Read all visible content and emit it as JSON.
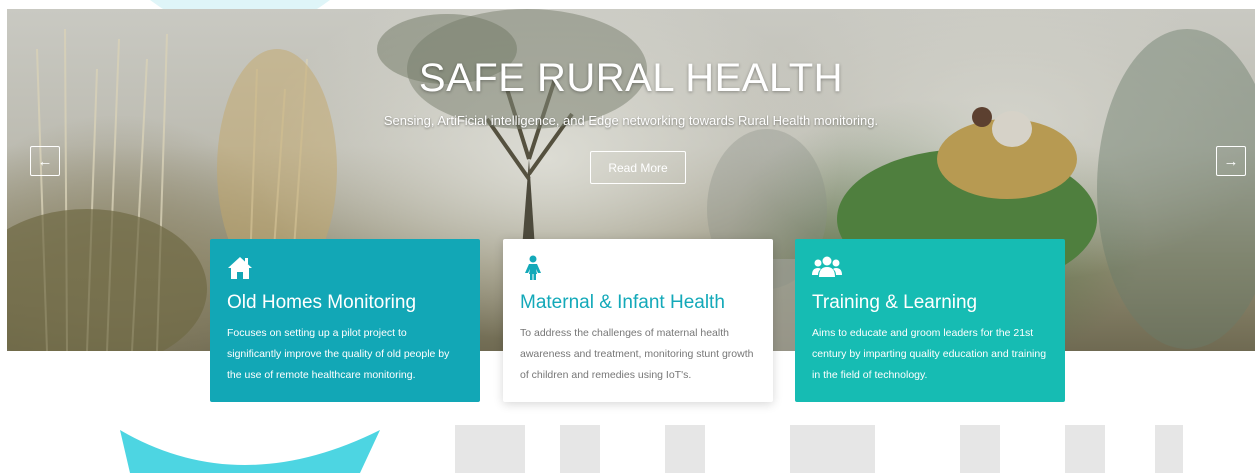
{
  "hero": {
    "title": "SAFE RURAL HEALTH",
    "subtitle": "Sensing, ArtiFicial intelligence, and Edge networking towards Rural Health monitoring.",
    "read_more_label": "Read More",
    "prev_arrow": "←",
    "next_arrow": "→"
  },
  "cards": [
    {
      "icon": "home-icon",
      "title": "Old Homes Monitoring",
      "text": "Focuses on setting up a pilot project to significantly improve the quality of old people by the use of remote healthcare monitoring."
    },
    {
      "icon": "female-person-icon",
      "title": "Maternal & Infant Health",
      "text": "To address the challenges of maternal health awareness and treatment, monitoring stunt growth of children and remedies using IoT's."
    },
    {
      "icon": "users-group-icon",
      "title": "Training & Learning",
      "text": "Aims to educate and groom leaders for the 21st century by imparting quality education and training in the field of technology."
    }
  ],
  "colors": {
    "teal": "#12a7b6",
    "green": "#16bcb3",
    "accent_text": "#13a9b9",
    "watermark_cyan": "#3ad0df",
    "watermark_gray": "#e6e6e6"
  }
}
